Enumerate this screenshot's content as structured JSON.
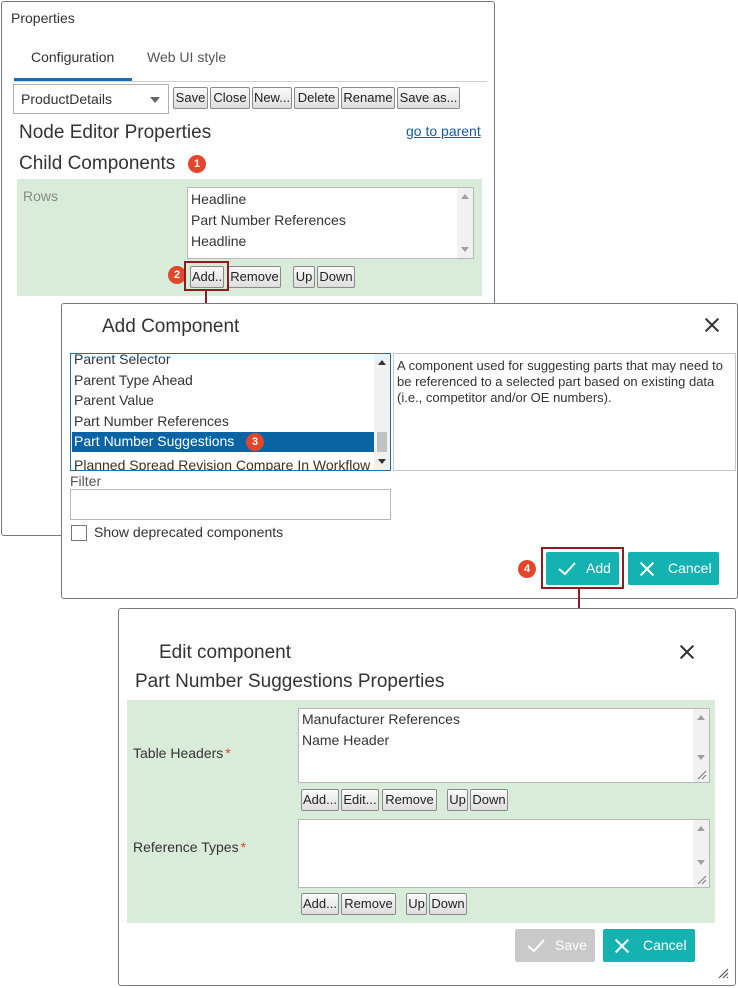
{
  "properties": {
    "title": "Properties",
    "tabs": [
      {
        "label": "Configuration",
        "active": true
      },
      {
        "label": "Web UI style",
        "active": false
      }
    ],
    "select_value": "ProductDetails",
    "toolbar": [
      "Save",
      "Close",
      "New...",
      "Delete",
      "Rename",
      "Save as..."
    ],
    "heading": "Node Editor Properties",
    "go_to_parent": "go to parent",
    "child_components": "Child Components",
    "rows_label": "Rows",
    "rows": [
      "Headline",
      "Part Number References",
      "Headline"
    ],
    "row_buttons": [
      "Add..",
      "Remove",
      "Up",
      "Down"
    ]
  },
  "add_component": {
    "title": "Add Component",
    "list": [
      "Parent Selector",
      "Parent Type Ahead",
      "Parent Value",
      "Part Number References",
      "Part Number Suggestions",
      "Planned Spread Revision Compare In Workflow"
    ],
    "selected_index": 4,
    "description": "A component used for suggesting parts that may need to be referenced to a selected part based on existing data (i.e., competitor and/or OE numbers).",
    "filter_label": "Filter",
    "filter_value": "",
    "show_deprecated": "Show deprecated components",
    "add_label": "Add",
    "cancel_label": "Cancel"
  },
  "edit_component": {
    "title": "Edit component",
    "subtitle": "Part Number Suggestions Properties",
    "table_headers_label": "Table Headers",
    "table_headers": [
      "Manufacturer References",
      "Name Header"
    ],
    "table_buttons": [
      "Add...",
      "Edit...",
      "Remove",
      "Up",
      "Down"
    ],
    "reference_types_label": "Reference Types",
    "reference_buttons": [
      "Add...",
      "Remove",
      "Up",
      "Down"
    ],
    "required_mark": "*",
    "save_label": "Save",
    "cancel_label": "Cancel"
  },
  "badges": [
    "1",
    "2",
    "3",
    "4"
  ],
  "colors": {
    "accent": "#15b2b2",
    "selection": "#0a64a4",
    "badge": "#e2472b",
    "highlight_box": "#8c1c22",
    "panel_green": "#d9ecda",
    "link": "#1a5a9a"
  }
}
